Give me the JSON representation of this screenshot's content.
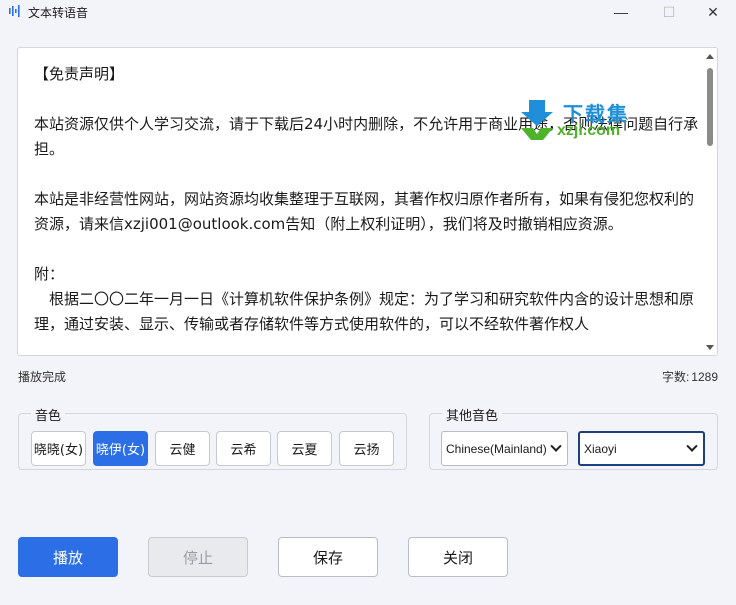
{
  "window": {
    "title": "文本转语音",
    "minimize_glyph": "—",
    "maximize_glyph": "☐",
    "close_glyph": "✕"
  },
  "editor": {
    "text": "【免责声明】\n\n本站资源仅供个人学习交流，请于下载后24小时内删除，不允许用于商业用途，否则法律问题自行承担。\n\n本站是非经营性网站，网站资源均收集整理于互联网，其著作权归原作者所有，如果有侵犯您权利的资源，请来信xzji001@outlook.com告知（附上权利证明），我们将及时撤销相应资源。\n\n附：\n　根据二〇〇二年一月一日《计算机软件保护条例》规定：为了学习和研究软件内含的设计思想和原理，通过安装、显示、传输或者存储软件等方式使用软件的，可以不经软件著作权人"
  },
  "watermark": {
    "line1": "下载集",
    "line2": "xzji.com"
  },
  "status": {
    "message": "播放完成",
    "char_count_label": "字数:",
    "char_count": "1289"
  },
  "voice_group": {
    "label": "音色",
    "options": [
      {
        "label": "晓晓(女)",
        "selected": false
      },
      {
        "label": "晓伊(女)",
        "selected": true
      },
      {
        "label": "云健",
        "selected": false
      },
      {
        "label": "云希",
        "selected": false
      },
      {
        "label": "云夏",
        "selected": false
      },
      {
        "label": "云扬",
        "selected": false
      }
    ]
  },
  "other_voice_group": {
    "label": "其他音色",
    "language_value": "Chinese(Mainland)",
    "voice_value": "Xiaoyi"
  },
  "actions": {
    "play": "播放",
    "stop": "停止",
    "save": "保存",
    "close": "关闭"
  },
  "colors": {
    "accent": "#2b6ee6",
    "background": "#f3f4f9",
    "disabled_text": "#9a9ca3"
  }
}
